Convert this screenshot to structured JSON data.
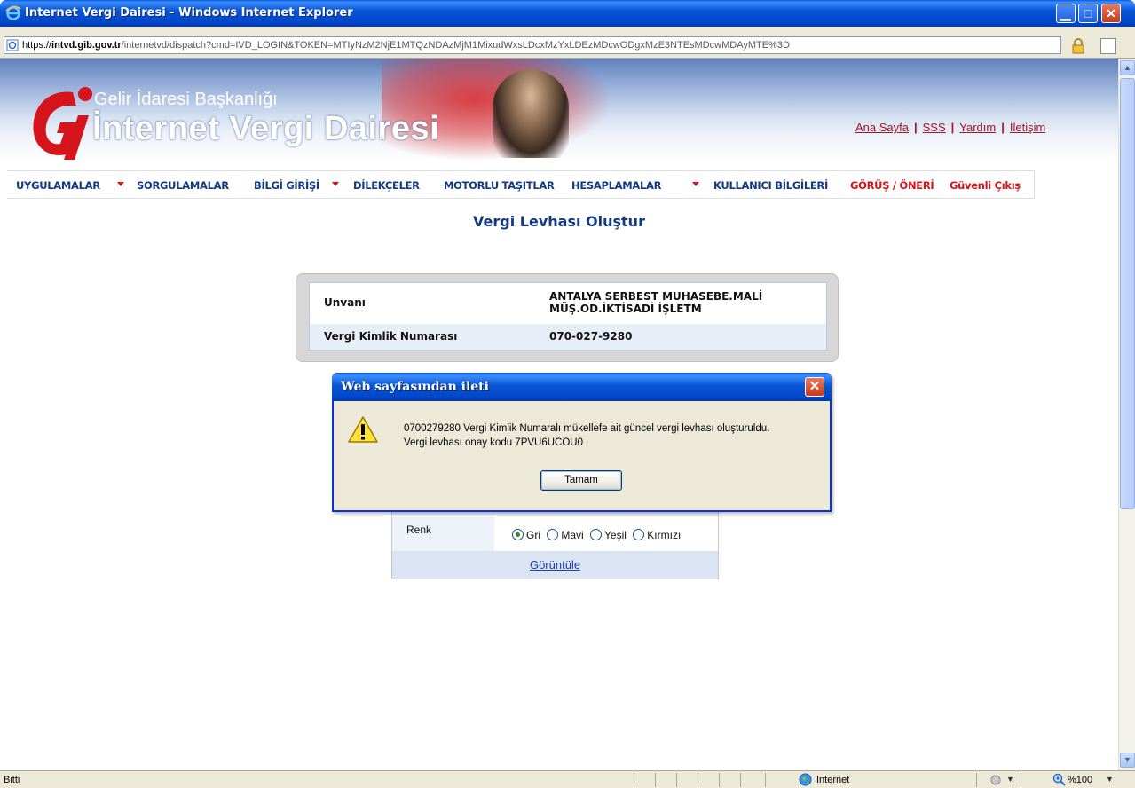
{
  "window": {
    "title": "Internet Vergi Dairesi - Windows Internet Explorer",
    "address_host_prefix": "https://",
    "address_host": "intvd.gib.gov.tr",
    "address_path": "/internetvd/dispatch?cmd=IVD_LOGIN&TOKEN=MTIyNzM2NjE1MTQzNDAzMjM1MixudWxsLDcxMzYxLDEzMDcwODgxMzE3NTEsMDcwMDAyMTE%3D"
  },
  "header": {
    "org": "Gelir İdaresi Başkanlığı",
    "app": "İnternet Vergi Dairesi",
    "links": [
      "Ana Sayfa",
      "SSS",
      "Yardım",
      "İletişim"
    ],
    "separator": "|"
  },
  "menu": {
    "items": [
      "UYGULAMALAR",
      "SORGULAMALAR",
      "BİLGİ GİRİŞİ",
      "DİLEKÇELER",
      "MOTORLU TAŞITLAR",
      "HESAPLAMALAR",
      "KULLANICI BİLGİLERİ",
      "GÖRÜŞ / ÖNERİ",
      "Güvenli Çıkış"
    ]
  },
  "page": {
    "title": "Vergi Levhası Oluştur"
  },
  "taxpayer": {
    "unvan_label": "Unvanı",
    "unvan_line1": "ANTALYA SERBEST MUHASEBE.MALİ",
    "unvan_line2": "MÜŞ.OD.İKTİSADİ İŞLETM",
    "vkn_label": "Vergi Kimlik Numarası",
    "vkn_value": "070-027-9280"
  },
  "options": {
    "renk_label": "Renk",
    "colors": [
      "Gri",
      "Mavi",
      "Yeşil",
      "Kırmızı"
    ],
    "selected": "Gri",
    "view_link": "Görüntüle"
  },
  "dialog": {
    "title": "Web sayfasından ileti",
    "message_line1": "0700279280 Vergi Kimlik Numaralı mükellefe ait güncel vergi levhası oluşturuldu.",
    "message_line2": "Vergi levhası onay kodu 7PVU6UCOU0",
    "ok_label": "Tamam"
  },
  "statusbar": {
    "status": "Bitti",
    "zone": "Internet",
    "zoom": "%100"
  },
  "colors": {
    "menu_blue": "#123a84",
    "menu_red": "#d6141c",
    "link_red": "#a0132a",
    "xp_blue": "#0a55d6"
  }
}
